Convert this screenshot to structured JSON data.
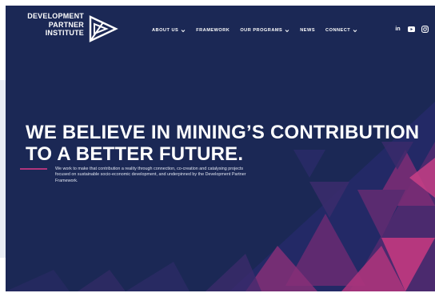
{
  "brand": {
    "name_lines": [
      "DEVELOPMENT",
      "PARTNER",
      "INSTITUTE"
    ]
  },
  "nav": {
    "items": [
      {
        "label": "ABOUT US",
        "dropdown": true
      },
      {
        "label": "FRAMEWORK",
        "dropdown": false
      },
      {
        "label": "OUR PROGRAMS",
        "dropdown": true
      },
      {
        "label": "NEWS",
        "dropdown": false
      },
      {
        "label": "CONNECT",
        "dropdown": true
      }
    ]
  },
  "social": {
    "icons": [
      "linkedin-icon",
      "youtube-icon",
      "instagram-icon"
    ],
    "linkedin_glyph": "in"
  },
  "hero": {
    "headline_lines": [
      "WE BELIEVE IN MINING’S CONTRIBUTION",
      "TO A BETTER FUTURE."
    ],
    "lede": "We work to make that contribution a reality through connection, co-creation and catalysing projects focused on sustainable socio-economic development, and underpinned by the Development Partner Framework."
  },
  "colors": {
    "background": "#1b2855",
    "accent": "#b0357c",
    "pattern_dark": "#2a2d6a",
    "pattern_mid": "#6a2a72",
    "pattern_light": "#c2387f"
  }
}
